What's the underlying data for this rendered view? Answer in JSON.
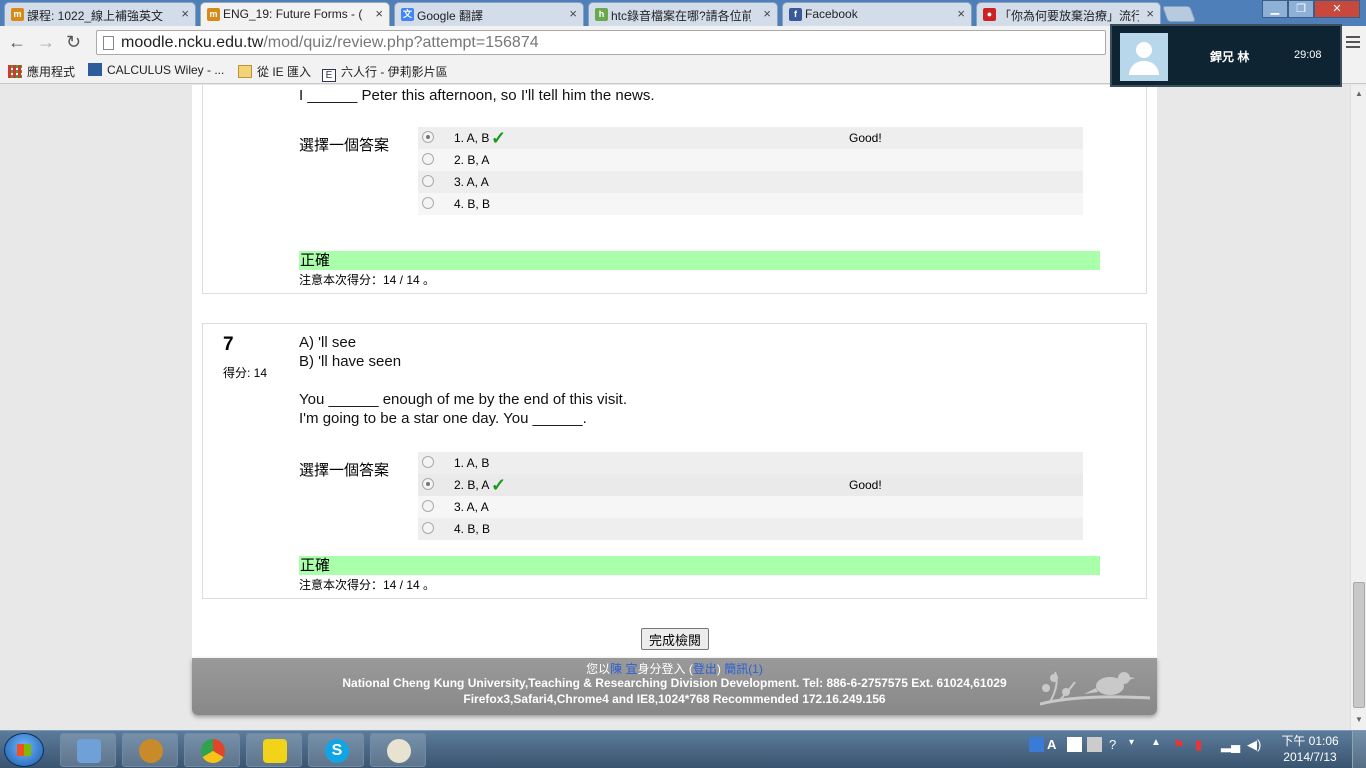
{
  "browser": {
    "tabs": [
      {
        "label": "課程: 1022_線上補強英文",
        "icon_color": "#d88a18",
        "icon_text": "m"
      },
      {
        "label": "ENG_19: Future Forms - (",
        "icon_color": "#d88a18",
        "icon_text": "m"
      },
      {
        "label": "Google 翻譯",
        "icon_color": "#4285f4",
        "icon_text": "文"
      },
      {
        "label": "htc錄音檔案在哪?請各位前",
        "icon_color": "#6aa84f",
        "icon_text": "h"
      },
      {
        "label": "Facebook",
        "icon_color": "#3b5998",
        "icon_text": "f"
      },
      {
        "label": "「你為何要放棄治療」流行",
        "icon_color": "#cc2222",
        "icon_text": "●"
      }
    ],
    "url_host": "moodle.ncku.edu.tw",
    "url_path": "/mod/quiz/review.php?attempt=156874",
    "bookmarks": [
      {
        "label": "應用程式",
        "icon": "apps-icon"
      },
      {
        "label": "CALCULUS Wiley - ...",
        "icon": "wiley-icon"
      },
      {
        "label": "從 IE 匯入",
        "icon": "folder-icon"
      },
      {
        "label": "六人行 - 伊莉影片區",
        "icon": "e-icon"
      }
    ]
  },
  "call_popup": {
    "name": "銲兄 林",
    "time": "29:08"
  },
  "quiz": {
    "q6_tail_text": "I ______ Peter this afternoon, so I'll tell him the news.",
    "choose_prompt": "選擇一個答案",
    "correct_label": "正確",
    "notice": "注意本次得分：14 / 14 。",
    "feedback": "Good!",
    "q6_answers": [
      {
        "label": "1. A, B",
        "selected": true,
        "correct": true
      },
      {
        "label": "2. B, A",
        "selected": false,
        "correct": false
      },
      {
        "label": "3. A, A",
        "selected": false,
        "correct": false
      },
      {
        "label": "4. B, B",
        "selected": false,
        "correct": false
      }
    ],
    "q7": {
      "number": "7",
      "grade": "得分: 14",
      "option_a": "A) 'll see",
      "option_b": "B) 'll have seen",
      "sentence1": "You ______ enough of me by the end of this visit.",
      "sentence2": "I'm going to be a star one day. You ______.",
      "answers": [
        {
          "label": "1. A, B",
          "selected": false,
          "correct": false
        },
        {
          "label": "2. B, A",
          "selected": true,
          "correct": true
        },
        {
          "label": "3. A, A",
          "selected": false,
          "correct": false
        },
        {
          "label": "4. B, B",
          "selected": false,
          "correct": false
        }
      ]
    },
    "finish_button": "完成檢閱"
  },
  "footer": {
    "login_prefix": "您以",
    "user_name": "陳 宜",
    "login_mid": "身分登入 (",
    "logout": "登出",
    "login_close": ")",
    "messages": "簡訊(1)",
    "line2": "National Cheng Kung University,Teaching & Researching Division Development. Tel: 886-6-2757575 Ext. 61024,61029",
    "line3": "Firefox3,Safari4,Chrome4 and IE8,1024*768 Recommended 172.16.249.156"
  },
  "taskbar": {
    "clock_time": "下午 01:06",
    "clock_date": "2014/7/13",
    "apps": [
      {
        "name": "explorer-icon",
        "color": "#6fa0d8"
      },
      {
        "name": "hearthstone-icon",
        "color": "#c98a2a"
      },
      {
        "name": "chrome-icon",
        "color": "#e0452c"
      },
      {
        "name": "kakao-icon",
        "color": "#f3d21a"
      },
      {
        "name": "skype-icon",
        "color": "#12a5e6"
      },
      {
        "name": "paint-icon",
        "color": "#e8e3d0"
      }
    ]
  }
}
